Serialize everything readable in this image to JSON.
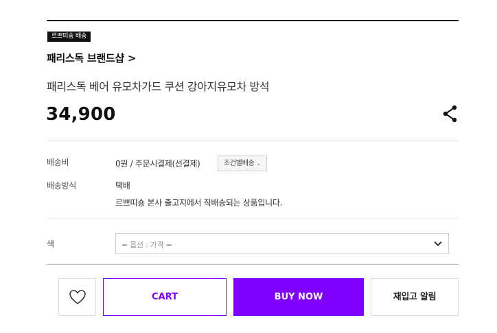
{
  "badge": "르쁘띠숑 배송",
  "brand_link": "패리스독 브랜드샵 >",
  "product_title": "패리스독 베어 유모차가드 쿠션 강아지유모차 방석",
  "price": "34,900",
  "icons": {
    "share": "share-icon",
    "wishlist": "heart-icon",
    "select_arrow": "chevron-down-icon"
  },
  "shipping": {
    "fee_label": "배송비",
    "fee_value": "0원  / 주문시결제(선결제)",
    "conditional_button": "조건별배송",
    "method_label": "배송방식",
    "method_value": "택배",
    "method_note": "르쁘띠숑 본사 출고지에서 직배송되는 상품입니다."
  },
  "option": {
    "label": "색",
    "placeholder": "= 옵션 : 가격 ="
  },
  "actions": {
    "cart": "CART",
    "buy_now": "BUY NOW",
    "restock_alert": "재입고 알림"
  },
  "colors": {
    "accent": "#8000ff",
    "accent_border": "#7a00ff"
  }
}
